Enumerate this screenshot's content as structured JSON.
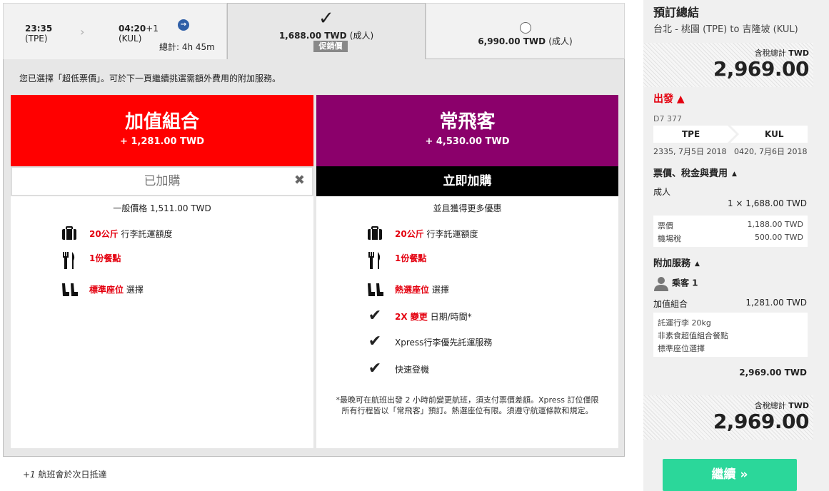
{
  "flight": {
    "dep_time": "23:35",
    "dep_code": "(TPE)",
    "arrow": "›",
    "arr_time": "04:20",
    "arr_plus": "+1",
    "arr_code": "(KUL)",
    "plane_icon": "→",
    "total_duration": "總計: 4h 45m"
  },
  "fares": [
    {
      "price": "1,688.00 TWD",
      "unit": "(成人)",
      "badge": "促銷價",
      "selected": true,
      "check": "✓"
    },
    {
      "price": "6,990.00 TWD",
      "unit": "(成人)",
      "selected": false
    }
  ],
  "notice": "您已選擇「超低票價」。可於下一頁繼續挑選需額外費用的附加服務。",
  "bundles": {
    "value_pack": {
      "name": "加值組合",
      "price": "+ 1,281.00 TWD",
      "status": "已加購",
      "remove": "✖",
      "subtitle": "一般價格 1,511.00 TWD",
      "features": [
        {
          "icon": "luggage-icon",
          "highlight": "20公斤",
          "text": " 行李託運額度"
        },
        {
          "icon": "meal-icon",
          "highlight": "1份餐點",
          "text": ""
        },
        {
          "icon": "seat-icon",
          "highlight": "標準座位",
          "text": " 選擇"
        }
      ]
    },
    "frequent_flyer": {
      "name": "常飛客",
      "price": "+ 4,530.00 TWD",
      "action": "立即加購",
      "subtitle": "並且獲得更多優惠",
      "features": [
        {
          "icon": "luggage-icon",
          "highlight": "20公斤",
          "text": " 行李託運額度"
        },
        {
          "icon": "meal-icon",
          "highlight": "1份餐點",
          "text": ""
        },
        {
          "icon": "seat-icon",
          "highlight": "熱選座位",
          "text": " 選擇"
        },
        {
          "icon": "check-icon",
          "highlight": "2X 變更",
          "text": " 日期/時間*"
        },
        {
          "icon": "check-icon",
          "highlight": "",
          "text": "Xpress行李優先託運服務"
        },
        {
          "icon": "check-icon",
          "highlight": "",
          "text": "快速登機"
        }
      ],
      "footnote_line1": "*最晚可在航班出發 2 小時前變更航班，須支付票價差額。Xpress 訂位僅限",
      "footnote_line2": "所有行程皆以「常飛客」預訂。熱選座位有限。須遵守航運條款和規定。"
    }
  },
  "footer_note_prefix": "+1",
  "footer_note": " 航班會於次日抵達",
  "summary": {
    "title": "預訂總結",
    "route": "台北 - 桃園 (TPE) to 吉隆坡 (KUL)",
    "total_label": "含稅總計",
    "currency": "TWD",
    "total": "2,969.00",
    "depart_label": "出發",
    "depart_caret": "▲",
    "flight_no": "D7 377",
    "from": "TPE",
    "to": "KUL",
    "dep_datetime": "2335, 7月5日 2018",
    "arr_datetime": "0420, 7月6日 2018",
    "fare_section": "票價、稅金與費用",
    "caret_up": "▲",
    "adult_label": "成人",
    "adult_fare": "1 × 1,688.00 TWD",
    "fare_label": "票價",
    "fare_value": "1,188.00 TWD",
    "tax_label": "機場稅",
    "tax_value": "500.00 TWD",
    "addon_section": "附加服務",
    "passenger": "乘客 1",
    "addon_name": "加值組合",
    "addon_price": "1,281.00 TWD",
    "addon_items": [
      "託運行李 20kg",
      "非素食超值組合餐點",
      "標準座位選擇"
    ],
    "subtotal": "2,969.00 TWD",
    "continue_label": "繼續 »"
  }
}
